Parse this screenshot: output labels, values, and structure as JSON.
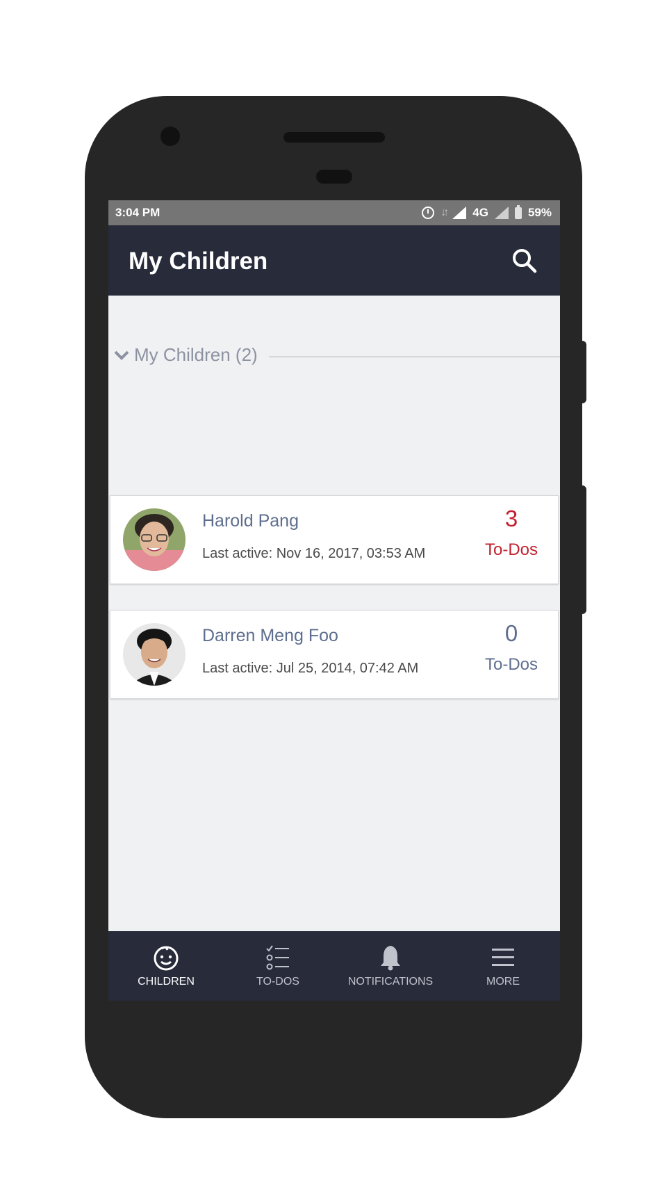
{
  "status_bar": {
    "time": "3:04 PM",
    "network": "4G",
    "battery": "59%",
    "icons": [
      "alarm-icon",
      "data-arrows-icon",
      "signal-icon",
      "signal-icon",
      "battery-icon"
    ]
  },
  "app_bar": {
    "title": "My Children",
    "search_icon": "search-icon"
  },
  "section": {
    "title": "My Children (2)",
    "icon": "chevron-down-icon"
  },
  "children": [
    {
      "name": "Harold Pang",
      "last_active": "Last active: Nov 16, 2017, 03:53 AM",
      "todo_count": "3",
      "todo_label": "To-Dos",
      "count_color": "#c0202e"
    },
    {
      "name": "Darren Meng Foo",
      "last_active": "Last active: Jul 25, 2014, 07:42 AM",
      "todo_count": "0",
      "todo_label": "To-Dos",
      "count_color": "#5e6e8e"
    }
  ],
  "bottom_nav": {
    "items": [
      {
        "label": "CHILDREN",
        "icon": "child-face-icon",
        "active": true
      },
      {
        "label": "TO-DOS",
        "icon": "checklist-icon",
        "active": false
      },
      {
        "label": "NOTIFICATIONS",
        "icon": "bell-icon",
        "active": false
      },
      {
        "label": "MORE",
        "icon": "menu-icon",
        "active": false
      }
    ]
  },
  "colors": {
    "app_bar": "#272b3a",
    "screen_bg": "#f0f1f3",
    "accent_red": "#c0202e",
    "name_blue": "#5e6e8e"
  }
}
